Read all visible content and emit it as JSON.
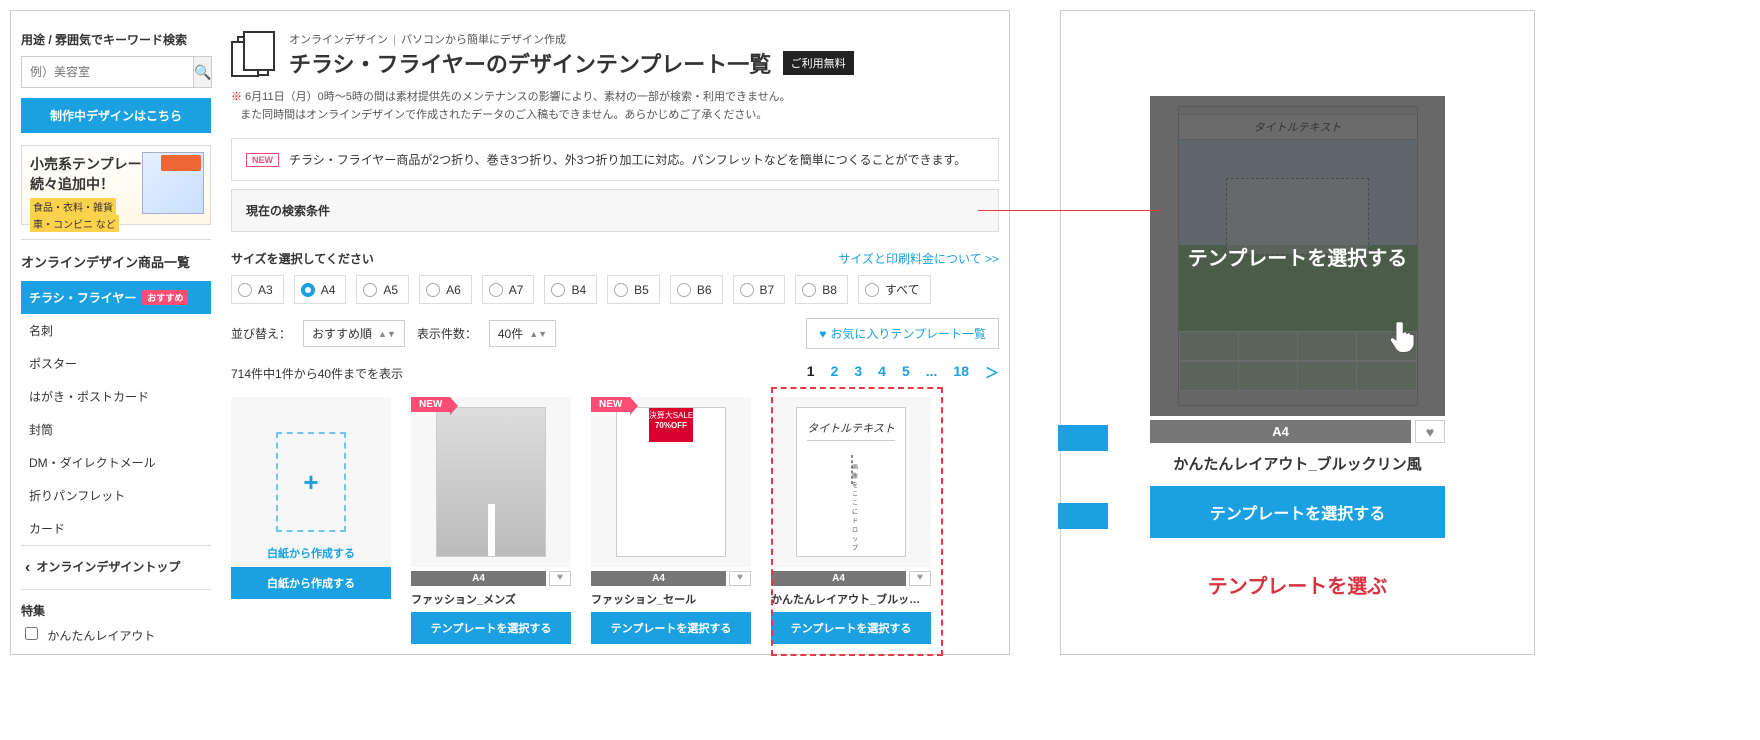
{
  "sidebar": {
    "search_label": "用途 / 雰囲気でキーワード検索",
    "search_placeholder": "例）美容室",
    "cta_design": "制作中デザインはこちら",
    "promo": {
      "line1": "小売系テンプレートが",
      "line2": "続々追加中！",
      "tag1": "食品・衣料・雑貨",
      "tag2": "車・コンビニ など"
    },
    "product_list_title": "オンラインデザイン商品一覧",
    "nav": [
      {
        "label": "チラシ・フライヤー",
        "badge": "おすすめ",
        "active": true
      },
      {
        "label": "名刺"
      },
      {
        "label": "ポスター"
      },
      {
        "label": "はがき・ポストカード"
      },
      {
        "label": "封筒"
      },
      {
        "label": "DM・ダイレクトメール"
      },
      {
        "label": "折りパンフレット"
      },
      {
        "label": "カード"
      }
    ],
    "back_link": "オンラインデザイントップ",
    "filter_title": "特集",
    "filter_item": "かんたんレイアウト"
  },
  "main": {
    "breadcrumb": {
      "a": "オンラインデザイン",
      "b": "パソコンから簡単にデザイン作成"
    },
    "heading": "チラシ・フライヤーのデザインテンプレート一覧",
    "free_badge": "ご利用無料",
    "notice_prefix": "※",
    "notice_line1": " 6月11日（月）0時〜5時の間は素材提供先のメンテナンスの影響により、素材の一部が検索・利用できません。",
    "notice_line2": "また同時間はオンラインデザインで作成されたデータのご入稿もできません。あらかじめご了承ください。",
    "info_bar": "チラシ・フライヤー商品が2つ折り、巻き3つ折り、外3つ折り加工に対応。パンフレットなどを簡単につくることができます。",
    "new_tag": "NEW",
    "cond_title": "現在の検索条件",
    "size_label": "サイズを選択してください",
    "size_link": "サイズと印刷料金について >>",
    "sizes": [
      "A3",
      "A4",
      "A5",
      "A6",
      "A7",
      "B4",
      "B5",
      "B6",
      "B7",
      "B8",
      "すべて"
    ],
    "size_active_index": 1,
    "sort_label": "並び替え：",
    "sort_value": "おすすめ順",
    "count_label": "表示件数：",
    "count_value": "40件",
    "fav_link": "お気に入りテンプレート一覧",
    "result_text": "714件中1件から40件までを表示",
    "pages": [
      "1",
      "2",
      "3",
      "4",
      "5",
      "...",
      "18",
      "＞"
    ],
    "cards": [
      {
        "kind": "blank",
        "caption": "白紙から作成する",
        "btn": "白紙から作成する"
      },
      {
        "kind": "fashion1",
        "ribbon": "NEW",
        "size": "A4",
        "name": "ファッション_メンズ",
        "btn": "テンプレートを選択する"
      },
      {
        "kind": "fashion2",
        "ribbon": "NEW",
        "size": "A4",
        "name": "ファッション_セール",
        "btn": "テンプレートを選択する",
        "sale_top": "決算大SALE",
        "sale_pct": "70%OFF"
      },
      {
        "kind": "easy",
        "size": "A4",
        "name": "かんたんレイアウト_ブルックリン風",
        "btn": "テンプレートを選択する",
        "tpl_title": "タイトルテキスト",
        "drop_text": "画像をここに\nドロップ",
        "highlighted": true
      }
    ]
  },
  "right": {
    "overlay_text": "テンプレートを選択する",
    "tpl_title": "タイトルテキスト",
    "size": "A4",
    "name": "かんたんレイアウト_ブルックリン風",
    "btn": "テンプレートを選択する",
    "caption": "テンプレートを選ぶ"
  }
}
